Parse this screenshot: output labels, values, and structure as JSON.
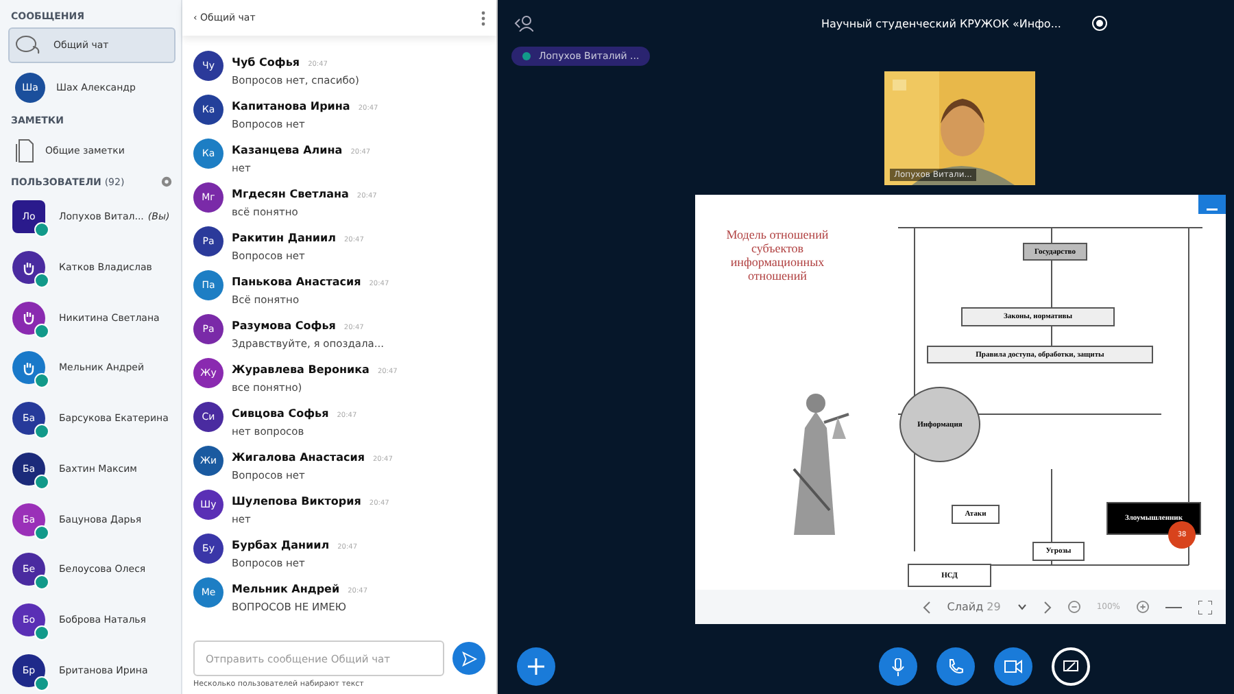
{
  "sidebar": {
    "messages_heading": "СООБЩЕНИЯ",
    "chats": [
      {
        "label": "Общий чат",
        "kind": "public",
        "selected": true
      },
      {
        "label": "Шах Александр",
        "kind": "private",
        "initials": "Ша",
        "color": "#1b4f9c",
        "selected": false
      }
    ],
    "notes_heading": "ЗАМЕТКИ",
    "notes": [
      {
        "label": "Общие заметки"
      }
    ],
    "users_heading": "ПОЛЬЗОВАТЕЛИ",
    "users_count": "(92)",
    "users": [
      {
        "name": "Лопухов Витал...",
        "you": "(Вы)",
        "initials": "Ло",
        "color": "#2a1a8c",
        "presenter": true
      },
      {
        "name": "Катков Владислав",
        "color": "#4a2ba0",
        "status": true
      },
      {
        "name": "Никитина Светлана",
        "color": "#8a2ab0",
        "status": true
      },
      {
        "name": "Мельник Андрей",
        "color": "#1979c9",
        "status": true
      },
      {
        "name": "Барсукова Екатерина",
        "initials": "Ба",
        "color": "#263a9a"
      },
      {
        "name": "Бахтин Максим",
        "initials": "Ба",
        "color": "#1b2a7a"
      },
      {
        "name": "Бацунова Дарья",
        "initials": "Ба",
        "color": "#9a30b8"
      },
      {
        "name": "Белоусова Олеся",
        "initials": "Бе",
        "color": "#4a2ba0"
      },
      {
        "name": "Боброва Наталья",
        "initials": "Бо",
        "color": "#5a2fb5"
      },
      {
        "name": "Британова Ирина",
        "initials": "Бр",
        "color": "#1f2a8a"
      }
    ]
  },
  "chat": {
    "title": "Общий чат",
    "back": "‹",
    "messages": [
      {
        "name": "Чуб Софья",
        "time": "20:47",
        "text": "Вопросов нет, спасибо)",
        "initials": "Чу",
        "color": "#2b3a9a"
      },
      {
        "name": "Капитанова Ирина",
        "time": "20:47",
        "text": "Вопросов нет",
        "initials": "Ка",
        "color": "#23409a"
      },
      {
        "name": "Казанцева Алина",
        "time": "20:47",
        "text": "нет",
        "initials": "Ка",
        "color": "#1d7ec4"
      },
      {
        "name": "Мгдесян Светлана",
        "time": "20:47",
        "text": "всё понятно",
        "initials": "Мг",
        "color": "#7a2aa8"
      },
      {
        "name": "Ракитин Даниил",
        "time": "20:47",
        "text": "Вопросов нет",
        "initials": "Ра",
        "color": "#2b3a9a"
      },
      {
        "name": "Панькова Анастасия",
        "time": "20:47",
        "text": "Всё понятно",
        "initials": "Па",
        "color": "#1d7ec4"
      },
      {
        "name": "Разумова Софья",
        "time": "20:47",
        "text": "Здравствуйте, я опоздала...",
        "initials": "Ра",
        "color": "#7a2aa8"
      },
      {
        "name": "Журавлева Вероника",
        "time": "20:47",
        "text": "все понятно)",
        "initials": "Жу",
        "color": "#8a2ab0"
      },
      {
        "name": "Сивцова Софья",
        "time": "20:47",
        "text": "нет вопросов",
        "initials": "Си",
        "color": "#4a2ba0"
      },
      {
        "name": "Жигалова Анастасия",
        "time": "20:47",
        "text": "Вопросов нет",
        "initials": "Жи",
        "color": "#1a5aa0"
      },
      {
        "name": "Шулепова Виктория",
        "time": "20:47",
        "text": "нет",
        "initials": "Шу",
        "color": "#5a2fb5"
      },
      {
        "name": "Бурбах Даниил",
        "time": "20:47",
        "text": "Вопросов нет",
        "initials": "Бу",
        "color": "#3a36a8"
      },
      {
        "name": "Мельник Андрей",
        "time": "20:47",
        "text": "ВОПРОСОВ НЕ ИМЕЮ",
        "initials": "Ме",
        "color": "#1d7ec4"
      }
    ],
    "input_placeholder": "Отправить сообщение Общий чат",
    "typing": "Несколько пользователей набирают текст"
  },
  "main": {
    "title": "Научный студенческий КРУЖОК «Инфо...",
    "talker": "Лопухов Виталий ...",
    "webcam_name": "Лопухов Витали...",
    "slide": {
      "title": "Модель отношений субъектов информационных отношений",
      "nodes": [
        {
          "label": "Государство",
          "kind": "grey"
        },
        {
          "label": "Законы, нормативы",
          "kind": "light"
        },
        {
          "label": "Правила доступа, обработки, защиты",
          "kind": "light"
        },
        {
          "label": "Информация",
          "kind": "ellipse"
        },
        {
          "label": "Атаки",
          "kind": "plain"
        },
        {
          "label": "Злоумышленник",
          "kind": "black"
        },
        {
          "label": "Угрозы",
          "kind": "plain"
        },
        {
          "label": "НСД",
          "kind": "plain"
        }
      ],
      "badge": "38"
    },
    "slide_label": "Слайд",
    "slide_number": "29",
    "zoom": "100%"
  }
}
